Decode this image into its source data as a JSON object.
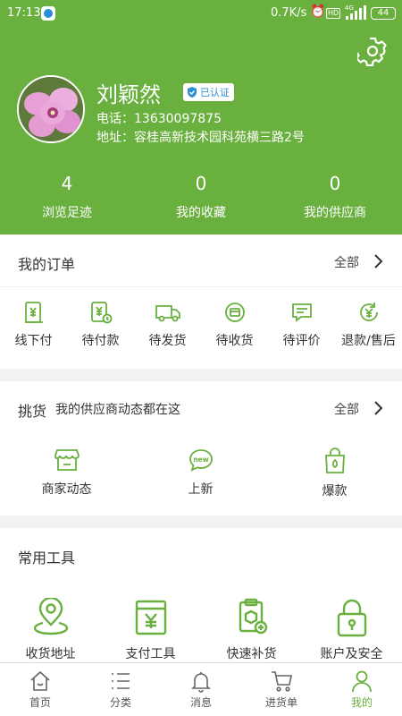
{
  "status_bar": {
    "time": "17:13",
    "speed": "0.7K/s",
    "hd": "HD",
    "network": "4G",
    "battery": "44"
  },
  "profile": {
    "name": "刘颖然",
    "verified_label": "已认证",
    "phone": "电话：13630097875",
    "address": "地址：容桂高新技术园科苑横三路2号"
  },
  "stats": [
    {
      "value": "4",
      "label": "浏览足迹"
    },
    {
      "value": "0",
      "label": "我的收藏"
    },
    {
      "value": "0",
      "label": "我的供应商"
    }
  ],
  "orders": {
    "title": "我的订单",
    "all_label": "全部",
    "items": [
      {
        "label": "线下付",
        "icon": "offline-pay-icon"
      },
      {
        "label": "待付款",
        "icon": "pending-payment-icon"
      },
      {
        "label": "待发货",
        "icon": "pending-shipment-icon"
      },
      {
        "label": "待收货",
        "icon": "pending-receipt-icon"
      },
      {
        "label": "待评价",
        "icon": "pending-review-icon"
      },
      {
        "label": "退款/售后",
        "icon": "refund-icon"
      }
    ]
  },
  "sourcing": {
    "title": "挑货",
    "subtitle": "我的供应商动态都在这",
    "all_label": "全部",
    "items": [
      {
        "label": "商家动态",
        "icon": "shop-icon"
      },
      {
        "label": "上新",
        "icon": "new-icon"
      },
      {
        "label": "爆款",
        "icon": "hot-bag-icon"
      }
    ]
  },
  "tools": {
    "title": "常用工具",
    "items": [
      {
        "label": "收货地址",
        "icon": "location-icon"
      },
      {
        "label": "支付工具",
        "icon": "payment-tool-icon"
      },
      {
        "label": "快速补货",
        "icon": "restock-icon"
      },
      {
        "label": "账户及安全",
        "icon": "lock-icon"
      }
    ]
  },
  "tabbar": [
    {
      "label": "首页",
      "icon": "home-icon",
      "active": false
    },
    {
      "label": "分类",
      "icon": "category-icon",
      "active": false
    },
    {
      "label": "消息",
      "icon": "bell-icon",
      "active": false
    },
    {
      "label": "进货单",
      "icon": "cart-icon",
      "active": false
    },
    {
      "label": "我的",
      "icon": "person-icon",
      "active": true
    }
  ],
  "colors": {
    "brand_green": "#6ab03f",
    "verified_blue": "#2e8fd0"
  }
}
